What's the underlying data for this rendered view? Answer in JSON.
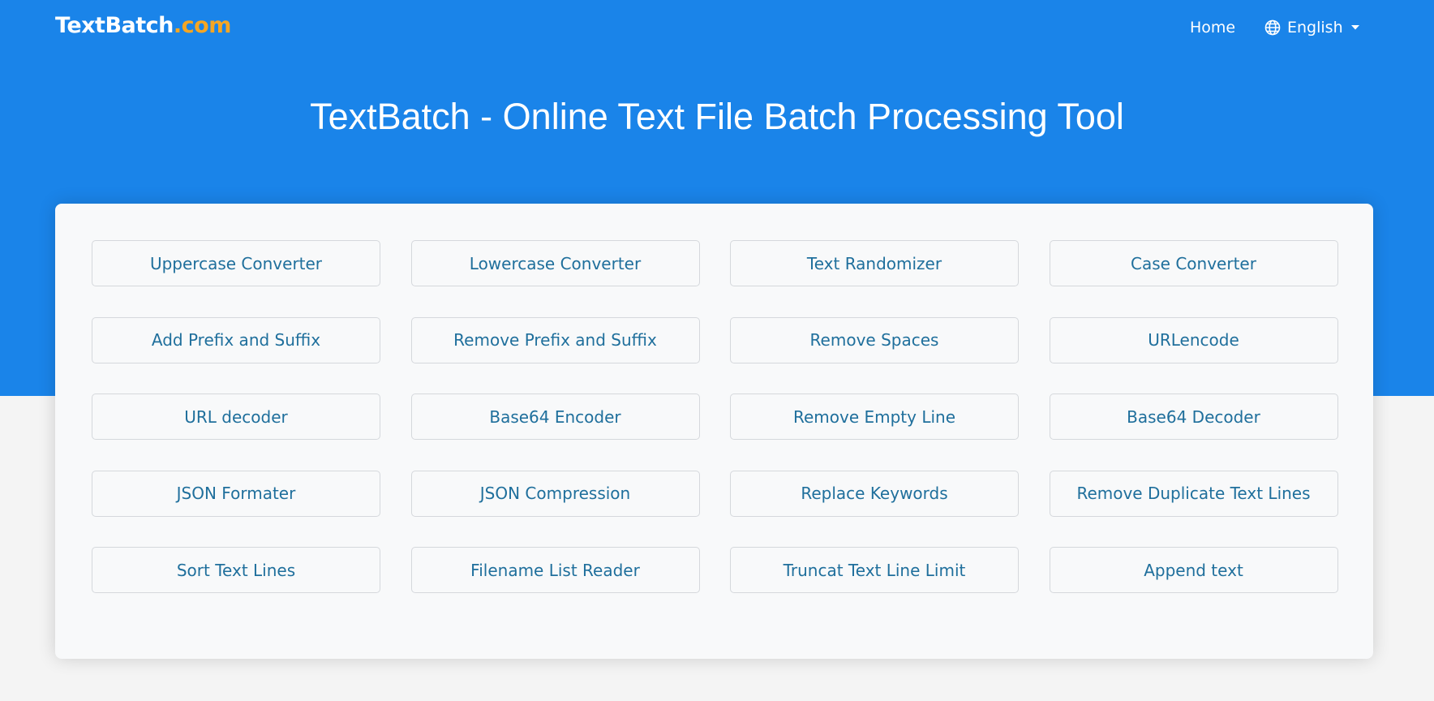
{
  "header": {
    "logo_main": "TextBatch",
    "logo_tld": ".com",
    "nav_home": "Home",
    "language": "English"
  },
  "hero": {
    "title": "TextBatch - Online Text File Batch Processing Tool"
  },
  "colors": {
    "hero_bg": "#1a84e9",
    "logo_accent": "#f5a623",
    "tool_text": "#1f6f9c",
    "page_bg": "#f4f4f4"
  },
  "tools": [
    "Uppercase Converter",
    "Lowercase Converter",
    "Text Randomizer",
    "Case Converter",
    "Add Prefix and Suffix",
    "Remove Prefix and Suffix",
    "Remove Spaces",
    "URLencode",
    "URL decoder",
    "Base64 Encoder",
    "Remove Empty Line",
    "Base64 Decoder",
    "JSON Formater",
    "JSON Compression",
    "Replace Keywords",
    "Remove Duplicate Text Lines",
    "Sort Text Lines",
    "Filename List Reader",
    "Truncat Text Line Limit",
    "Append text"
  ]
}
